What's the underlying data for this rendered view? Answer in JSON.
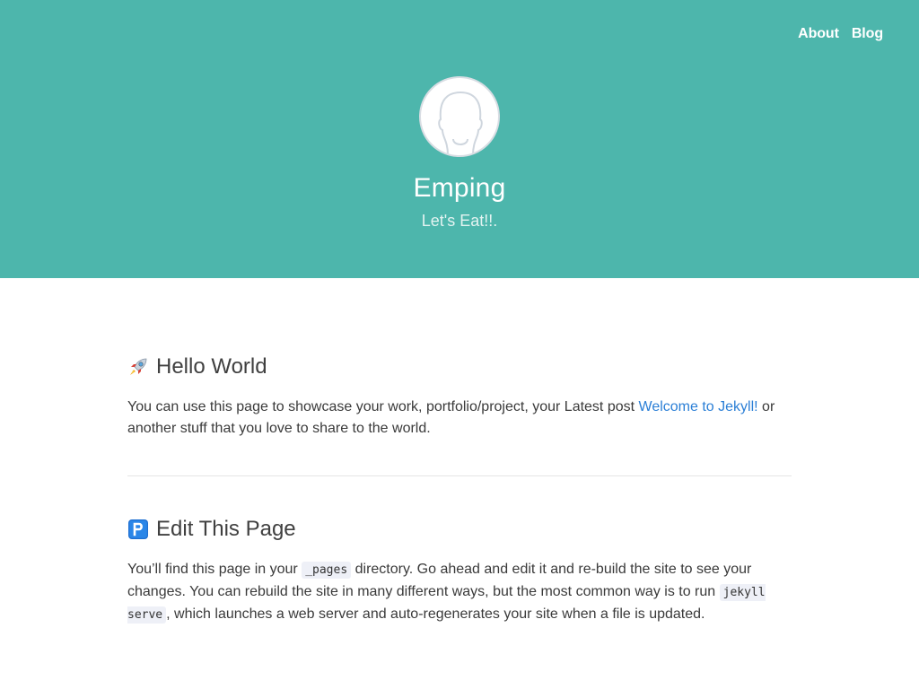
{
  "header": {
    "nav": [
      {
        "label": "About"
      },
      {
        "label": "Blog"
      }
    ],
    "avatar_icon": "user-silhouette-icon",
    "title": "Emping",
    "tagline": "Let's Eat!!.",
    "background_color": "#4db6ac"
  },
  "sections": [
    {
      "icon": "rocket-emoji-icon",
      "heading": "Hello World",
      "paragraph": {
        "text_before": "You can use this page to showcase your work, portfolio/project, your Latest post ",
        "link_text": "Welcome to Jekyll!",
        "text_after": " or another stuff that you love to share to the world."
      }
    },
    {
      "icon": "parking-p-emoji-icon",
      "heading": "Edit This Page",
      "paragraph": {
        "text_1": "You’ll find this page in your ",
        "code_1": "_pages",
        "text_2": " directory. Go ahead and edit it and re-build the site to see your changes. You can rebuild the site in many different ways, but the most common way is to run ",
        "code_2": "jekyll serve",
        "text_3": ", which launches a web server and auto-regenerates your site when a file is updated."
      }
    }
  ],
  "colors": {
    "accent": "#4db6ac",
    "link": "#2b7fd6"
  }
}
